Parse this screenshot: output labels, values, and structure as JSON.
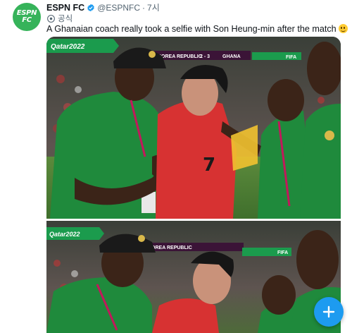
{
  "tweet": {
    "author_name": "ESPN FC",
    "handle": "@ESPNFC",
    "separator": "·",
    "time": "7시",
    "official_label": "공식",
    "text": "A Ghanaian coach really took a selfie with Son Heung-min after the match",
    "text_emoji": "grinning-face-emoji"
  },
  "avatar": {
    "logo": "ESPN FC",
    "logo_line1": "ESPN",
    "logo_line2": "FC",
    "color": "#36b35a"
  },
  "scoreboard": {
    "banner": "Qatar2022",
    "team_left": "KOREA REPUBLIC",
    "score": "2 - 3",
    "team_right": "GHANA",
    "sponsor": "FIFA"
  },
  "jersey_number": "7",
  "compose_button": {
    "icon": "plus-icon",
    "color": "#1d9bf0"
  },
  "colors": {
    "text": "#0f1419",
    "secondary": "#536471",
    "verified": "#1d9bf0"
  }
}
